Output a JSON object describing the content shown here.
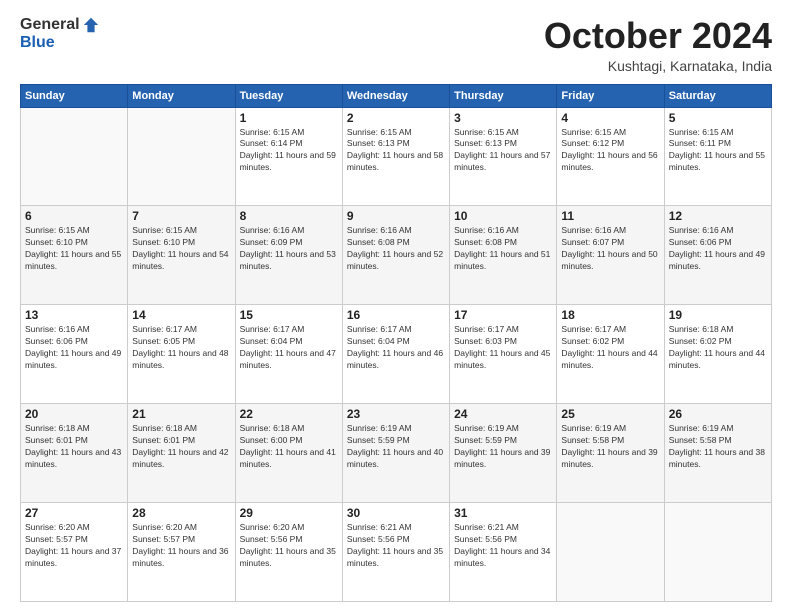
{
  "logo": {
    "general": "General",
    "blue": "Blue"
  },
  "header": {
    "month": "October 2024",
    "location": "Kushtagi, Karnataka, India"
  },
  "weekdays": [
    "Sunday",
    "Monday",
    "Tuesday",
    "Wednesday",
    "Thursday",
    "Friday",
    "Saturday"
  ],
  "weeks": [
    [
      {
        "day": "",
        "sunrise": "",
        "sunset": "",
        "daylight": ""
      },
      {
        "day": "",
        "sunrise": "",
        "sunset": "",
        "daylight": ""
      },
      {
        "day": "1",
        "sunrise": "Sunrise: 6:15 AM",
        "sunset": "Sunset: 6:14 PM",
        "daylight": "Daylight: 11 hours and 59 minutes."
      },
      {
        "day": "2",
        "sunrise": "Sunrise: 6:15 AM",
        "sunset": "Sunset: 6:13 PM",
        "daylight": "Daylight: 11 hours and 58 minutes."
      },
      {
        "day": "3",
        "sunrise": "Sunrise: 6:15 AM",
        "sunset": "Sunset: 6:13 PM",
        "daylight": "Daylight: 11 hours and 57 minutes."
      },
      {
        "day": "4",
        "sunrise": "Sunrise: 6:15 AM",
        "sunset": "Sunset: 6:12 PM",
        "daylight": "Daylight: 11 hours and 56 minutes."
      },
      {
        "day": "5",
        "sunrise": "Sunrise: 6:15 AM",
        "sunset": "Sunset: 6:11 PM",
        "daylight": "Daylight: 11 hours and 55 minutes."
      }
    ],
    [
      {
        "day": "6",
        "sunrise": "Sunrise: 6:15 AM",
        "sunset": "Sunset: 6:10 PM",
        "daylight": "Daylight: 11 hours and 55 minutes."
      },
      {
        "day": "7",
        "sunrise": "Sunrise: 6:15 AM",
        "sunset": "Sunset: 6:10 PM",
        "daylight": "Daylight: 11 hours and 54 minutes."
      },
      {
        "day": "8",
        "sunrise": "Sunrise: 6:16 AM",
        "sunset": "Sunset: 6:09 PM",
        "daylight": "Daylight: 11 hours and 53 minutes."
      },
      {
        "day": "9",
        "sunrise": "Sunrise: 6:16 AM",
        "sunset": "Sunset: 6:08 PM",
        "daylight": "Daylight: 11 hours and 52 minutes."
      },
      {
        "day": "10",
        "sunrise": "Sunrise: 6:16 AM",
        "sunset": "Sunset: 6:08 PM",
        "daylight": "Daylight: 11 hours and 51 minutes."
      },
      {
        "day": "11",
        "sunrise": "Sunrise: 6:16 AM",
        "sunset": "Sunset: 6:07 PM",
        "daylight": "Daylight: 11 hours and 50 minutes."
      },
      {
        "day": "12",
        "sunrise": "Sunrise: 6:16 AM",
        "sunset": "Sunset: 6:06 PM",
        "daylight": "Daylight: 11 hours and 49 minutes."
      }
    ],
    [
      {
        "day": "13",
        "sunrise": "Sunrise: 6:16 AM",
        "sunset": "Sunset: 6:06 PM",
        "daylight": "Daylight: 11 hours and 49 minutes."
      },
      {
        "day": "14",
        "sunrise": "Sunrise: 6:17 AM",
        "sunset": "Sunset: 6:05 PM",
        "daylight": "Daylight: 11 hours and 48 minutes."
      },
      {
        "day": "15",
        "sunrise": "Sunrise: 6:17 AM",
        "sunset": "Sunset: 6:04 PM",
        "daylight": "Daylight: 11 hours and 47 minutes."
      },
      {
        "day": "16",
        "sunrise": "Sunrise: 6:17 AM",
        "sunset": "Sunset: 6:04 PM",
        "daylight": "Daylight: 11 hours and 46 minutes."
      },
      {
        "day": "17",
        "sunrise": "Sunrise: 6:17 AM",
        "sunset": "Sunset: 6:03 PM",
        "daylight": "Daylight: 11 hours and 45 minutes."
      },
      {
        "day": "18",
        "sunrise": "Sunrise: 6:17 AM",
        "sunset": "Sunset: 6:02 PM",
        "daylight": "Daylight: 11 hours and 44 minutes."
      },
      {
        "day": "19",
        "sunrise": "Sunrise: 6:18 AM",
        "sunset": "Sunset: 6:02 PM",
        "daylight": "Daylight: 11 hours and 44 minutes."
      }
    ],
    [
      {
        "day": "20",
        "sunrise": "Sunrise: 6:18 AM",
        "sunset": "Sunset: 6:01 PM",
        "daylight": "Daylight: 11 hours and 43 minutes."
      },
      {
        "day": "21",
        "sunrise": "Sunrise: 6:18 AM",
        "sunset": "Sunset: 6:01 PM",
        "daylight": "Daylight: 11 hours and 42 minutes."
      },
      {
        "day": "22",
        "sunrise": "Sunrise: 6:18 AM",
        "sunset": "Sunset: 6:00 PM",
        "daylight": "Daylight: 11 hours and 41 minutes."
      },
      {
        "day": "23",
        "sunrise": "Sunrise: 6:19 AM",
        "sunset": "Sunset: 5:59 PM",
        "daylight": "Daylight: 11 hours and 40 minutes."
      },
      {
        "day": "24",
        "sunrise": "Sunrise: 6:19 AM",
        "sunset": "Sunset: 5:59 PM",
        "daylight": "Daylight: 11 hours and 39 minutes."
      },
      {
        "day": "25",
        "sunrise": "Sunrise: 6:19 AM",
        "sunset": "Sunset: 5:58 PM",
        "daylight": "Daylight: 11 hours and 39 minutes."
      },
      {
        "day": "26",
        "sunrise": "Sunrise: 6:19 AM",
        "sunset": "Sunset: 5:58 PM",
        "daylight": "Daylight: 11 hours and 38 minutes."
      }
    ],
    [
      {
        "day": "27",
        "sunrise": "Sunrise: 6:20 AM",
        "sunset": "Sunset: 5:57 PM",
        "daylight": "Daylight: 11 hours and 37 minutes."
      },
      {
        "day": "28",
        "sunrise": "Sunrise: 6:20 AM",
        "sunset": "Sunset: 5:57 PM",
        "daylight": "Daylight: 11 hours and 36 minutes."
      },
      {
        "day": "29",
        "sunrise": "Sunrise: 6:20 AM",
        "sunset": "Sunset: 5:56 PM",
        "daylight": "Daylight: 11 hours and 35 minutes."
      },
      {
        "day": "30",
        "sunrise": "Sunrise: 6:21 AM",
        "sunset": "Sunset: 5:56 PM",
        "daylight": "Daylight: 11 hours and 35 minutes."
      },
      {
        "day": "31",
        "sunrise": "Sunrise: 6:21 AM",
        "sunset": "Sunset: 5:56 PM",
        "daylight": "Daylight: 11 hours and 34 minutes."
      },
      {
        "day": "",
        "sunrise": "",
        "sunset": "",
        "daylight": ""
      },
      {
        "day": "",
        "sunrise": "",
        "sunset": "",
        "daylight": ""
      }
    ]
  ]
}
